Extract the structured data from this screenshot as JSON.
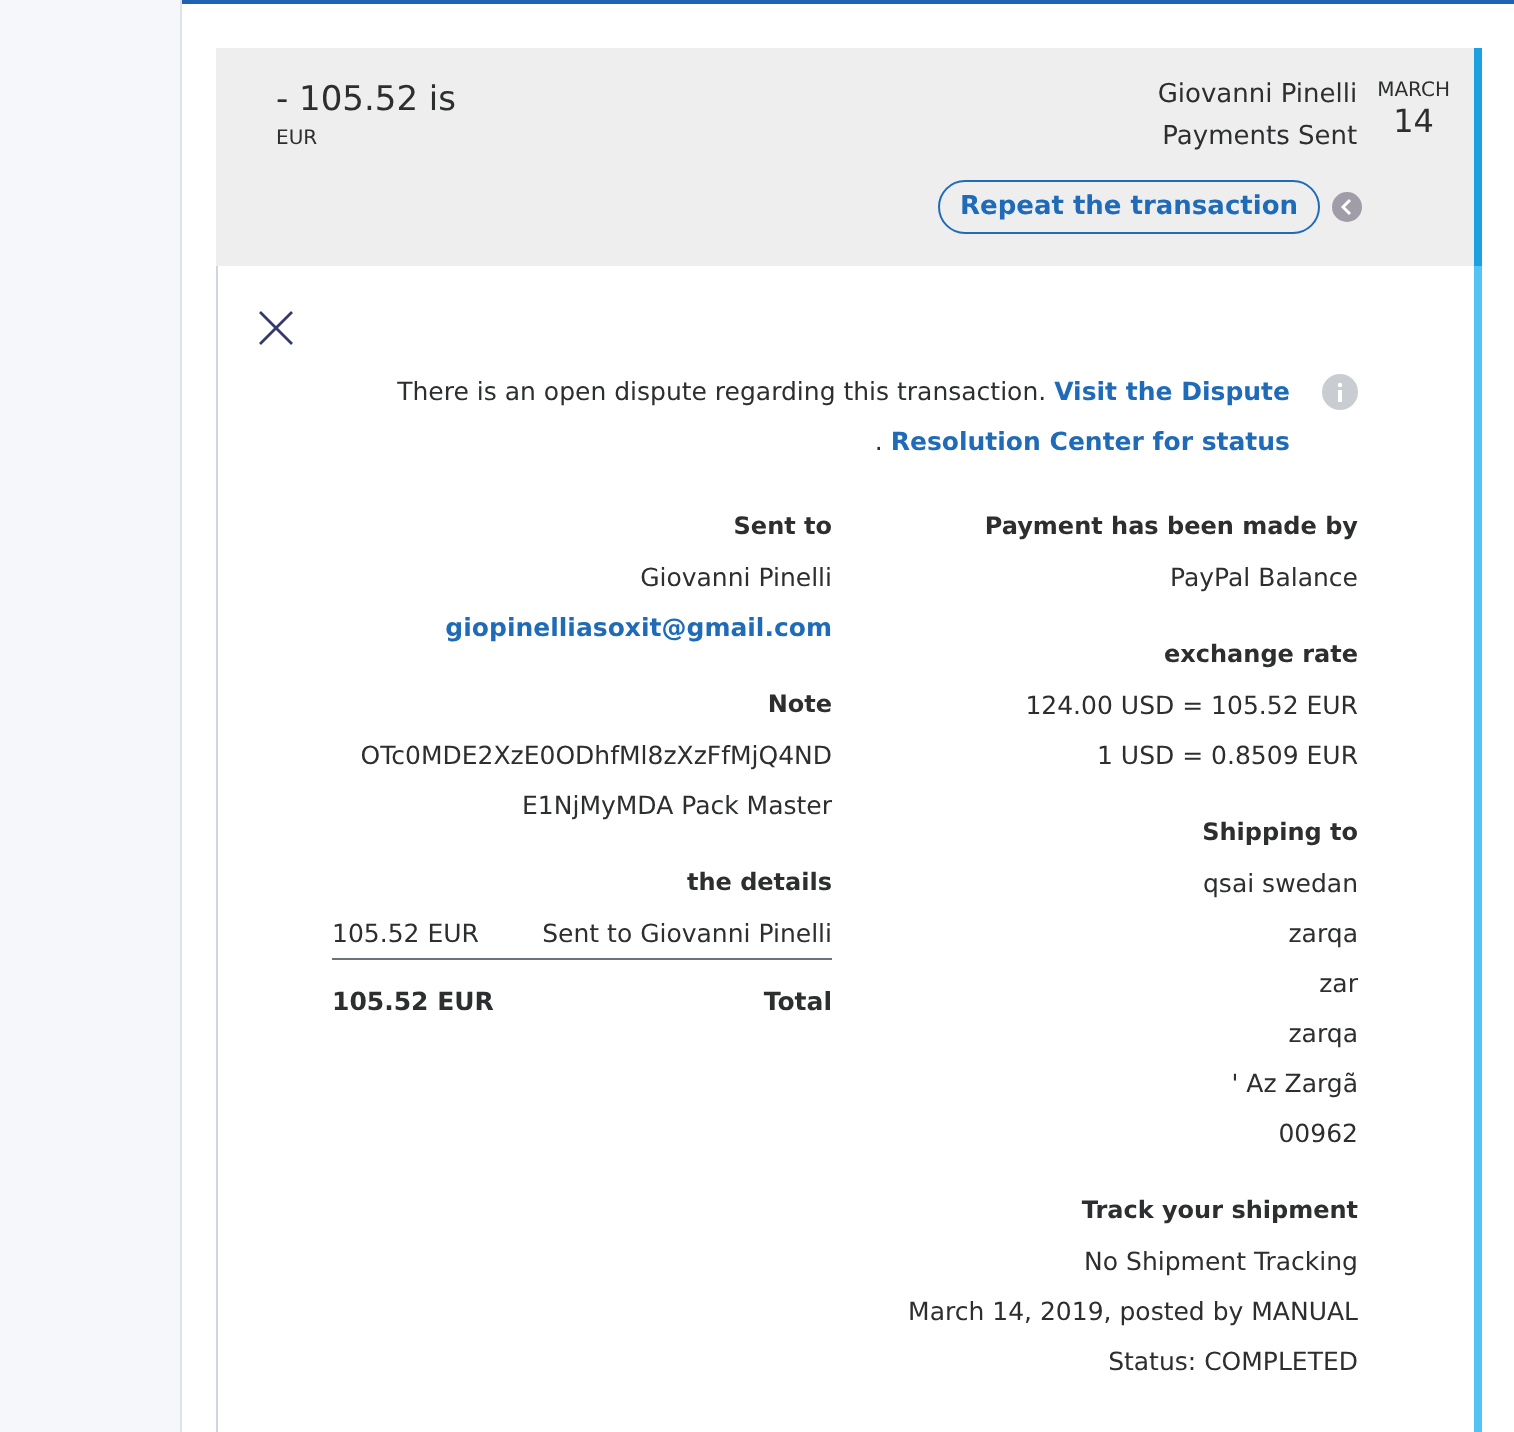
{
  "summary": {
    "amount": "- 105.52 is",
    "currency": "EUR",
    "name": "Giovanni Pinelli",
    "type": "Payments Sent",
    "month": "MARCH",
    "day": "14",
    "repeat_button": "Repeat the transaction"
  },
  "dispute": {
    "text": "There is an open dispute regarding this transaction.",
    "link_1": "Visit the Dispute",
    "prefix": ".",
    "link_2": "Resolution Center for status"
  },
  "left_sections": [
    {
      "title": "Sent to",
      "lines": [
        {
          "kind": "text",
          "text": "Giovanni Pinelli"
        },
        {
          "kind": "link",
          "text": "giopinelliasoxit@gmail.com"
        }
      ]
    },
    {
      "title": "Note",
      "lines": [
        {
          "kind": "text",
          "text": "OTc0MDE2XzE0ODhfMl8zXzFfMjQ4ND"
        },
        {
          "kind": "text",
          "text": "E1NjMyMDA Pack Master"
        }
      ]
    },
    {
      "title": "the details",
      "lines": [
        {
          "kind": "detail",
          "amount": "105.52 EUR",
          "text": "Sent to Giovanni Pinelli"
        },
        {
          "kind": "total",
          "amount": "105.52 EUR",
          "text": "Total"
        }
      ]
    }
  ],
  "right_sections": [
    {
      "title": "Payment has been made by",
      "lines": [
        {
          "kind": "text",
          "text": "PayPal Balance"
        }
      ]
    },
    {
      "title": "exchange rate",
      "lines": [
        {
          "kind": "text",
          "text": "124.00 USD = 105.52 EUR"
        },
        {
          "kind": "text",
          "text": "1 USD = 0.8509 EUR"
        }
      ]
    },
    {
      "title": "Shipping to",
      "lines": [
        {
          "kind": "text",
          "text": "qsai swedan"
        },
        {
          "kind": "text",
          "text": "zarqa"
        },
        {
          "kind": "text",
          "text": "zar"
        },
        {
          "kind": "text",
          "text": "zarqa"
        },
        {
          "kind": "text",
          "text": "' Az Zargã"
        },
        {
          "kind": "text",
          "text": "00962"
        }
      ]
    },
    {
      "title": "Track your shipment",
      "lines": [
        {
          "kind": "text",
          "text": "No Shipment Tracking"
        },
        {
          "kind": "text",
          "text": "March 14, 2019, posted by MANUAL"
        },
        {
          "kind": "text",
          "text": "Status: COMPLETED"
        }
      ]
    }
  ]
}
